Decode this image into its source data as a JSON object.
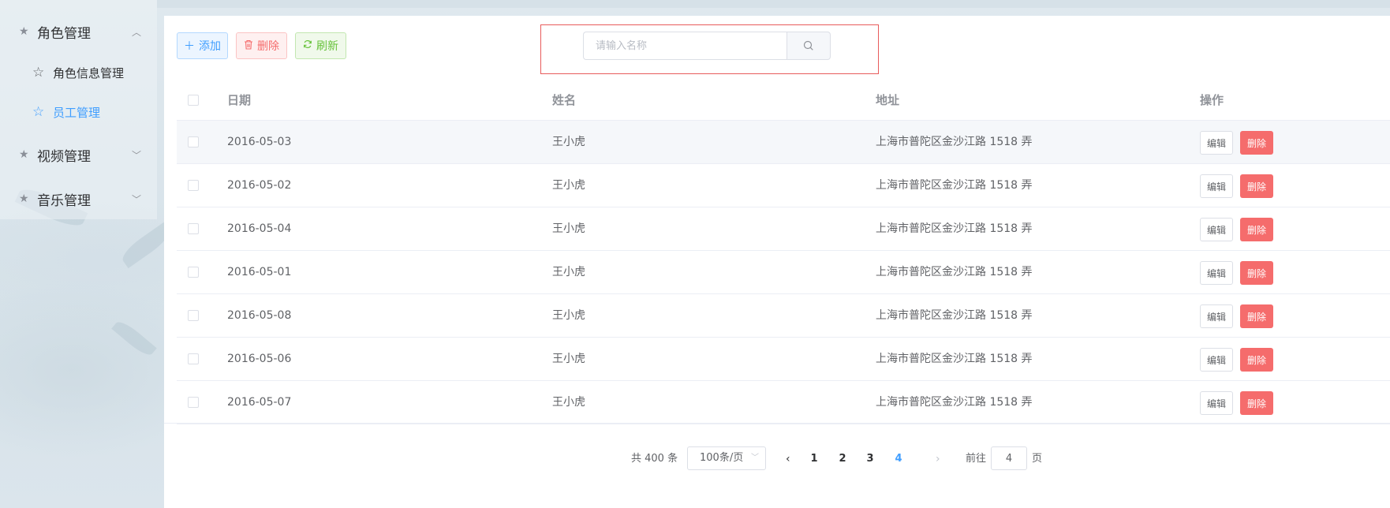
{
  "sidebar": {
    "groups": [
      {
        "label": "角色管理",
        "expanded": true
      },
      {
        "label": "视频管理",
        "expanded": false
      },
      {
        "label": "音乐管理",
        "expanded": false
      }
    ],
    "subitems": [
      {
        "label": "角色信息管理",
        "active": false
      },
      {
        "label": "员工管理",
        "active": true
      }
    ]
  },
  "toolbar": {
    "add_label": "添加",
    "delete_label": "删除",
    "refresh_label": "刷新"
  },
  "search": {
    "placeholder": "请输入名称",
    "value": ""
  },
  "table": {
    "columns": [
      "日期",
      "姓名",
      "地址",
      "操作"
    ],
    "rows": [
      {
        "date": "2016-05-03",
        "name": "王小虎",
        "address": "上海市普陀区金沙江路 1518 弄"
      },
      {
        "date": "2016-05-02",
        "name": "王小虎",
        "address": "上海市普陀区金沙江路 1518 弄"
      },
      {
        "date": "2016-05-04",
        "name": "王小虎",
        "address": "上海市普陀区金沙江路 1518 弄"
      },
      {
        "date": "2016-05-01",
        "name": "王小虎",
        "address": "上海市普陀区金沙江路 1518 弄"
      },
      {
        "date": "2016-05-08",
        "name": "王小虎",
        "address": "上海市普陀区金沙江路 1518 弄"
      },
      {
        "date": "2016-05-06",
        "name": "王小虎",
        "address": "上海市普陀区金沙江路 1518 弄"
      },
      {
        "date": "2016-05-07",
        "name": "王小虎",
        "address": "上海市普陀区金沙江路 1518 弄"
      }
    ],
    "edit_label": "编辑",
    "delete_label": "删除"
  },
  "pagination": {
    "total_text": "共 400 条",
    "page_size": "100条/页",
    "pages": [
      "1",
      "2",
      "3",
      "4"
    ],
    "current_page": "4",
    "goto_prefix": "前往",
    "goto_value": "4",
    "goto_suffix": "页"
  },
  "colors": {
    "primary": "#409eff",
    "danger": "#f56c6c",
    "success": "#67c23a",
    "highlight_border": "#e85b5b"
  },
  "icons": {
    "group": "star-filled-icon",
    "subitem": "star-outline-icon",
    "add": "plus-icon",
    "delete": "trash-icon",
    "refresh": "refresh-icon",
    "search": "search-icon"
  }
}
